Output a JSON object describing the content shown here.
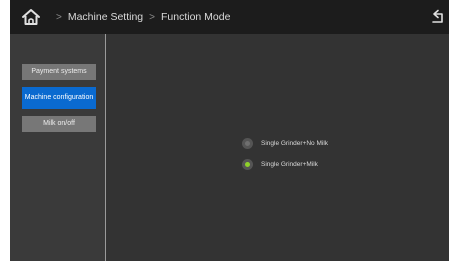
{
  "header": {
    "home_icon": "home-icon",
    "separator": ">",
    "breadcrumbs": [
      "Machine Setting",
      "Function Mode"
    ],
    "back_icon": "back-arrow-icon"
  },
  "sidebar": {
    "items": [
      {
        "label": "Payment systems",
        "active": false
      },
      {
        "label": "Machine configuration",
        "active": true
      },
      {
        "label": "Milk on/off",
        "active": false
      }
    ]
  },
  "main": {
    "options": [
      {
        "label": "Single Grinder+No Milk",
        "selected": false
      },
      {
        "label": "Single Grinder+Milk",
        "selected": true
      }
    ]
  },
  "colors": {
    "active_item": "#0a6ad0",
    "radio_selected": "#8fd12a",
    "background": "#333333",
    "topbar": "#1c1c1c"
  }
}
